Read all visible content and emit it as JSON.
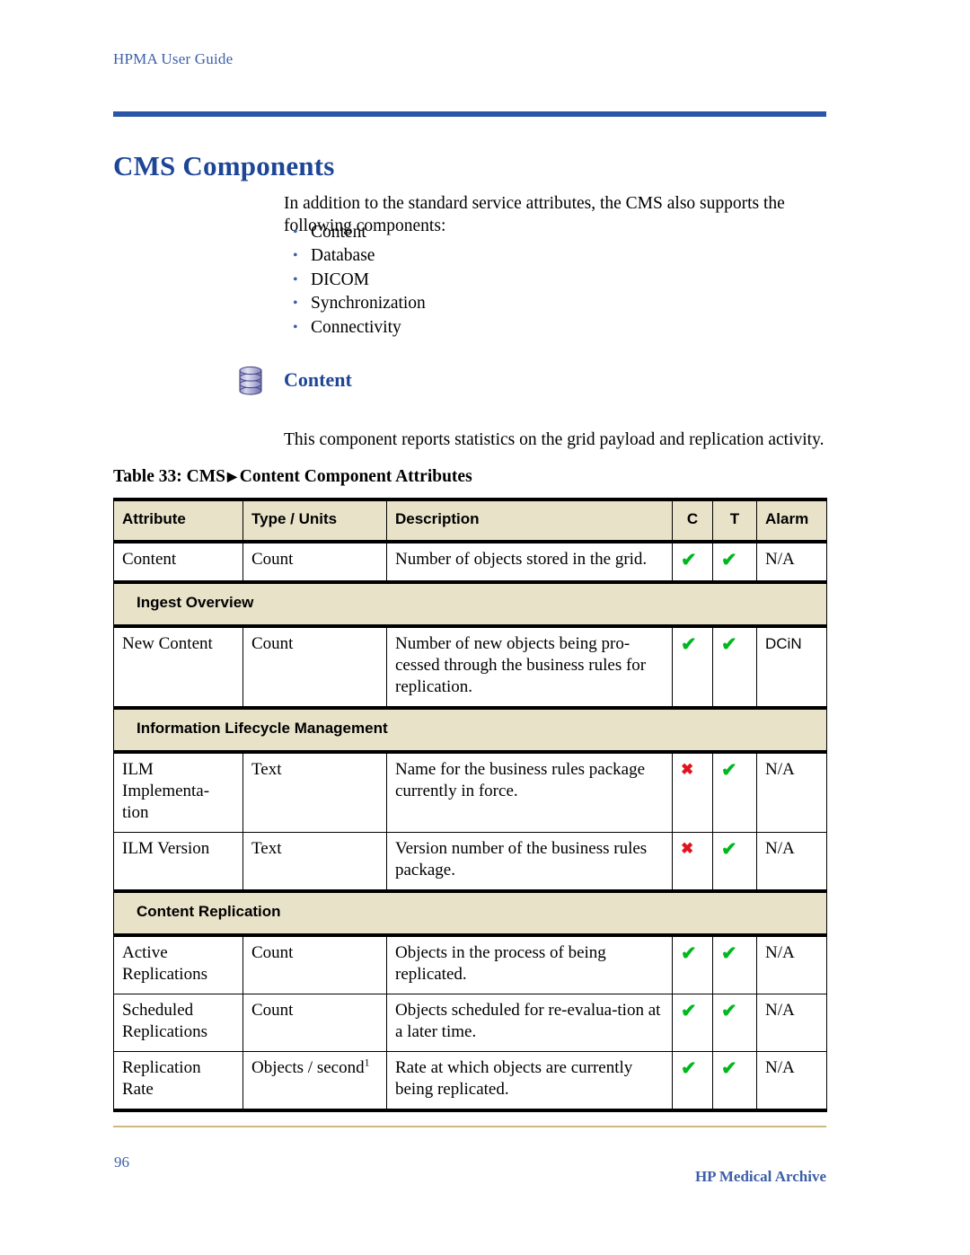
{
  "header": {
    "running_title": "HPMA User Guide",
    "accent_color": "#2b56a8"
  },
  "title": "CMS Components",
  "intro": "In addition to the standard service attributes, the CMS also supports the following components:",
  "bullets": [
    {
      "label": "Content"
    },
    {
      "label": "Database"
    },
    {
      "label": "DICOM"
    },
    {
      "label": "Synchronization"
    },
    {
      "label": "Connectivity"
    }
  ],
  "component": {
    "icon": "database-icon",
    "heading": "Content",
    "description": "This component reports statistics on the grid payload and replication activity."
  },
  "table": {
    "caption_prefix": "Table 33: CMS",
    "caption_arrow": "▶",
    "caption_suffix": "Content Component Attributes",
    "header_bg": "#e8e2c8",
    "columns": [
      {
        "label": "Attribute"
      },
      {
        "label": "Type / Units"
      },
      {
        "label": "Description"
      },
      {
        "label": "C"
      },
      {
        "label": "T"
      },
      {
        "label": "Alarm"
      }
    ],
    "rows": [
      {
        "kind": "data",
        "attribute": "Content",
        "type": "Count",
        "description": "Number of objects stored in the grid.",
        "c": "check",
        "t": "check",
        "alarm": "N/A",
        "alarm_sans": false
      },
      {
        "kind": "section",
        "label": "Ingest Overview"
      },
      {
        "kind": "data",
        "attribute": "New Content",
        "type": "Count",
        "description": "Number of new objects being pro-cessed through the business rules for replication.",
        "c": "check",
        "t": "check",
        "alarm": "DCiN",
        "alarm_sans": true
      },
      {
        "kind": "section",
        "label": "Information Lifecycle Management"
      },
      {
        "kind": "data",
        "attribute": "ILM Implementa-tion",
        "type": "Text",
        "description": "Name for the business rules package currently in force.",
        "c": "cross",
        "t": "check",
        "alarm": "N/A",
        "alarm_sans": false
      },
      {
        "kind": "data",
        "attribute": "ILM Version",
        "type": "Text",
        "description": "Version number of the business rules package.",
        "c": "cross",
        "t": "check",
        "alarm": "N/A",
        "alarm_sans": false
      },
      {
        "kind": "section",
        "label": "Content Replication"
      },
      {
        "kind": "data",
        "attribute": "Active Replications",
        "type": "Count",
        "description": "Objects in the process of being replicated.",
        "c": "check",
        "t": "check",
        "alarm": "N/A",
        "alarm_sans": false
      },
      {
        "kind": "data",
        "attribute": "Scheduled Replications",
        "type": "Count",
        "description": "Objects scheduled for re-evalua-tion at a later time.",
        "c": "check",
        "t": "check",
        "alarm": "N/A",
        "alarm_sans": false
      },
      {
        "kind": "data",
        "attribute": "Replication Rate",
        "type": "Objects / second",
        "type_sup": "1",
        "description": "Rate at which objects are currently being replicated.",
        "c": "check",
        "t": "check",
        "alarm": "N/A",
        "alarm_sans": false
      }
    ],
    "marks": {
      "check": "✔",
      "cross": "✖",
      "check_color": "#00b81e",
      "cross_color": "#e0141e"
    }
  },
  "footer": {
    "page_number": "96",
    "brand": "HP Medical Archive",
    "rule_color": "#cdb87f"
  }
}
